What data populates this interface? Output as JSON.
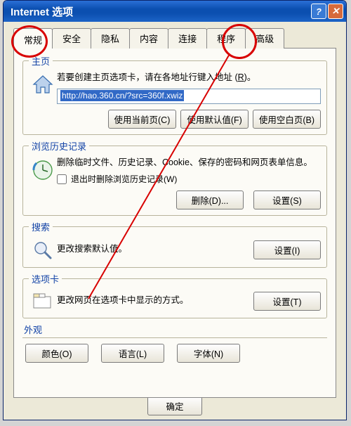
{
  "window": {
    "title": "Internet 选项"
  },
  "tabs": {
    "general": "常规",
    "security": "安全",
    "privacy": "隐私",
    "content": "内容",
    "connections": "连接",
    "programs": "程序",
    "advanced": "高级"
  },
  "homepage": {
    "legend": "主页",
    "desc_pre": "若要创建主页选项卡，请在各地址行键入地址 (",
    "desc_key": "R",
    "desc_post": ")。",
    "url": "http://hao.360.cn/?src=360f.xwiz",
    "use_current": "使用当前页(C)",
    "use_default": "使用默认值(F)",
    "use_blank": "使用空白页(B)"
  },
  "history": {
    "legend": "浏览历史记录",
    "desc": "删除临时文件、历史记录、Cookie、保存的密码和网页表单信息。",
    "checkbox": "退出时删除浏览历史记录(W)",
    "delete": "删除(D)...",
    "settings": "设置(S)"
  },
  "search": {
    "legend": "搜索",
    "desc": "更改搜索默认值。",
    "settings": "设置(I)"
  },
  "tabs_section": {
    "legend": "选项卡",
    "desc": "更改网页在选项卡中显示的方式。",
    "settings": "设置(T)"
  },
  "appearance": {
    "legend": "外观",
    "color": "颜色(O)",
    "language": "语言(L)",
    "font": "字体(N)"
  },
  "footer": {
    "ok": "确定"
  }
}
